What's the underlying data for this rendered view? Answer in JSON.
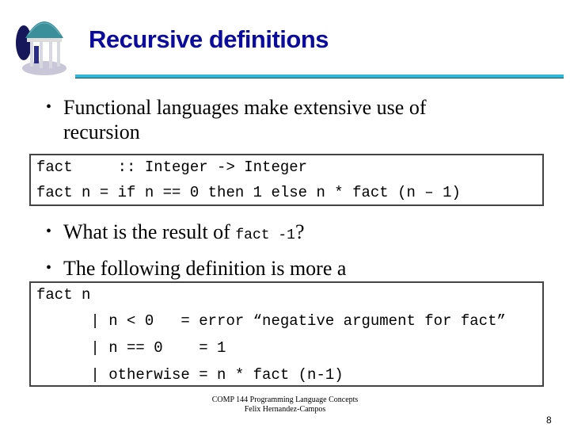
{
  "slide": {
    "title": "Recursive definitions",
    "logo_icon": "old-well-icon",
    "accent_color": "#2fb8d8",
    "title_color": "#0b0b9c"
  },
  "bullets": [
    {
      "text_line1": "Functional languages make extensive use of",
      "text_line2": "recursion"
    },
    {
      "text_before": "What is the result of ",
      "code": "fact -1",
      "text_after": "?"
    },
    {
      "text": "The following definition is more a"
    }
  ],
  "code_block_1": [
    "fact     :: Integer -> Integer",
    "fact n = if n == 0 then 1 else n * fact (n – 1)"
  ],
  "code_block_2": [
    "fact n",
    "      | n < 0   = error “negative argument for fact”",
    "      | n == 0    = 1",
    "      | otherwise = n * fact (n-1)"
  ],
  "footer": {
    "course": "COMP 144 Programming Language Concepts",
    "author": "Felix Hernandez-Campos",
    "page_number": "8"
  }
}
